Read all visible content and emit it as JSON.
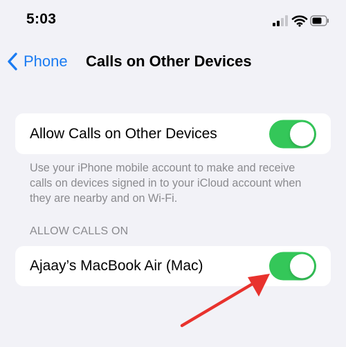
{
  "status_bar": {
    "time": "5:03",
    "icons": [
      "signal-icon",
      "wifi-icon",
      "battery-icon"
    ]
  },
  "nav": {
    "back_label": "Phone",
    "title": "Calls on Other Devices"
  },
  "main_setting": {
    "label": "Allow Calls on Other Devices",
    "toggle_on": true,
    "description": "Use your iPhone mobile account to make and receive calls on devices signed in to your iCloud account when they are nearby and on Wi-Fi."
  },
  "devices_section": {
    "header": "ALLOW CALLS ON",
    "items": [
      {
        "label": "Ajaay’s MacBook Air (Mac)",
        "toggle_on": true
      }
    ]
  },
  "colors": {
    "background": "#f2f2f7",
    "accent": "#1a7bf2",
    "toggle_on": "#34c759",
    "secondary_text": "#8a8a8e",
    "annotation_arrow": "#e8322d"
  }
}
